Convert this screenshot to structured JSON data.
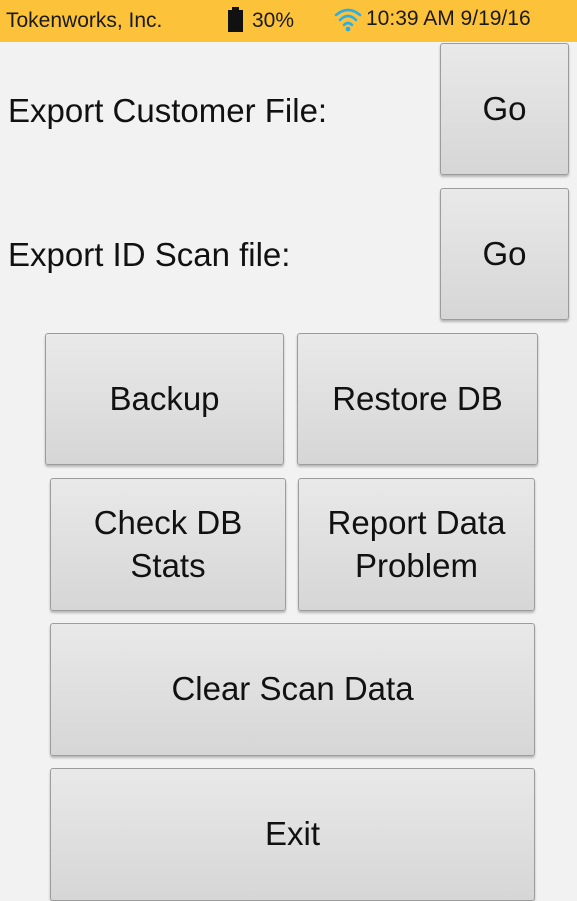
{
  "status_bar": {
    "carrier": "Tokenworks, Inc.",
    "battery_percent": "30%",
    "datetime": "10:39 AM 9/19/16",
    "background_color": "#fcc23a",
    "wifi_color": "#29aee8",
    "icons": [
      "battery-icon",
      "wifi-icon"
    ]
  },
  "export_customer": {
    "label": "Export Customer File:",
    "button": "Go"
  },
  "export_idscan": {
    "label": "Export ID Scan file:",
    "button": "Go"
  },
  "buttons": {
    "backup": "Backup",
    "restore_db": "Restore DB",
    "check_db_stats": "Check DB\nStats",
    "report_data_problem": "Report Data\nProblem",
    "clear_scan_data": "Clear Scan Data",
    "exit": "Exit"
  }
}
